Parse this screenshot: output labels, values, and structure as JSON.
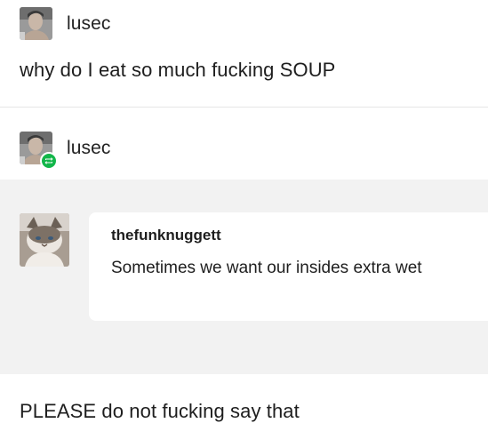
{
  "original_post": {
    "author": "lusec",
    "text": "why do I eat so much fucking SOUP"
  },
  "reblog": {
    "author": "lusec",
    "badge_icon": "reblog-icon",
    "badge_color": "#12b64a",
    "trail": {
      "author": "thefunknuggett",
      "text": "Sometimes we want our insides extra wet"
    },
    "reply_text": "PLEASE do not fucking say that"
  },
  "colors": {
    "trail_background": "#f2f2f2",
    "card_background": "#ffffff",
    "text": "#1e1e1e"
  }
}
